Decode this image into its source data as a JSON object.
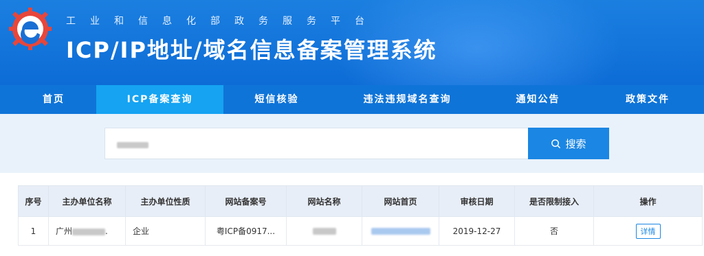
{
  "header": {
    "subtitle": "工业和信息化部政务服务平台",
    "title": "ICP/IP地址/域名信息备案管理系统",
    "logo_icon": "miit-gear-logo-icon"
  },
  "nav": {
    "items": [
      {
        "label": "首页",
        "active": false
      },
      {
        "label": "ICP备案查询",
        "active": true
      },
      {
        "label": "短信核验",
        "active": false
      },
      {
        "label": "违法违规域名查询",
        "active": false
      },
      {
        "label": "通知公告",
        "active": false
      },
      {
        "label": "政策文件",
        "active": false
      }
    ]
  },
  "search": {
    "value": "",
    "button_label": "搜索",
    "button_icon": "search-icon"
  },
  "table": {
    "headers": [
      "序号",
      "主办单位名称",
      "主办单位性质",
      "网站备案号",
      "网站名称",
      "网站首页",
      "审核日期",
      "是否限制接入",
      "操作"
    ],
    "rows": [
      {
        "index": "1",
        "org_name_prefix": "广州",
        "org_name_suffix": ".",
        "org_type": "企业",
        "icp_number": "粤ICP备0917...",
        "site_name": "",
        "homepage": "",
        "review_date": "2019-12-27",
        "restricted": "否",
        "action_label": "详情"
      }
    ]
  },
  "colors": {
    "header_bg": "#0d6cd6",
    "nav_bg": "#0f74d8",
    "nav_active": "#15a3f2",
    "search_band": "#e9f2fb",
    "button_blue": "#1b86e3"
  }
}
